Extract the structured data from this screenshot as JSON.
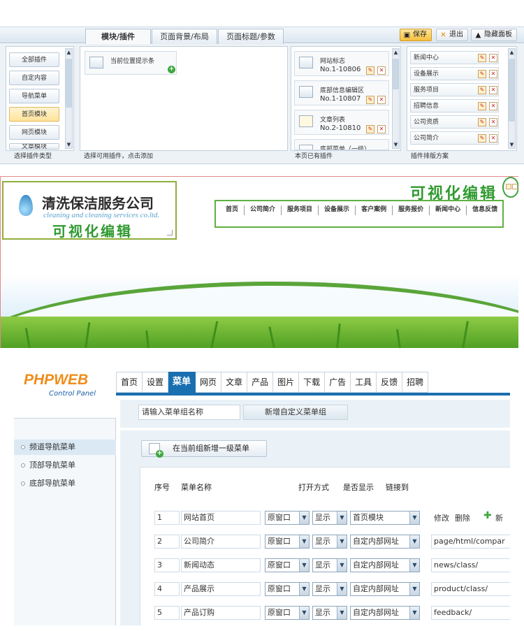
{
  "editor": {
    "tabs": [
      "模块/插件",
      "页面背景/布局",
      "页面标题/参数"
    ],
    "buttons": {
      "save": "保存",
      "exit": "退出",
      "hide": "隐藏面板"
    },
    "categories": [
      "全部插件",
      "自定内容",
      "导航菜单",
      "首页模块",
      "网页模块",
      "文章模块"
    ],
    "available_plugin": "当前位置提示条",
    "page_plugins": [
      {
        "name": "网站标志",
        "code": "No.1-10806"
      },
      {
        "name": "底部信息编辑区",
        "code": "No.1-10807"
      },
      {
        "name": "文章列表",
        "code": "No.2-10810"
      },
      {
        "name": "底部菜单（一级）",
        "code": ""
      }
    ],
    "layout_items": [
      "新闻中心",
      "设备展示",
      "服务项目",
      "招聘信息",
      "公司资质",
      "公司简介"
    ],
    "footers": [
      "选择插件类型",
      "选择可用插件，点击添加",
      "本页已有插件",
      "插件排版方案"
    ]
  },
  "preview": {
    "company_cn": "清洗保洁服务公司",
    "company_en": "cleaning and cleaning services co.ltd.",
    "visual_edit": "可视化编辑",
    "nav": [
      "首页",
      "公司简介",
      "服务项目",
      "设备展示",
      "客户案例",
      "服务报价",
      "新闻中心",
      "信息反馈"
    ]
  },
  "cp": {
    "logo_big": "PHPWEB",
    "logo_small": "Control Panel",
    "tabs": [
      "首页",
      "设置",
      "菜单",
      "网页",
      "文章",
      "产品",
      "图片",
      "下载",
      "广告",
      "工具",
      "反馈",
      "招聘"
    ],
    "group_placeholder": "请输入菜单组名称",
    "group_add": "新增自定义菜单组",
    "side": [
      "频道导航菜单",
      "顶部导航菜单",
      "底部导航菜单"
    ],
    "add_first": "在当前组新增一级菜单",
    "headers": {
      "seq": "序号",
      "name": "菜单名称",
      "open": "打开方式",
      "show": "是否显示",
      "link": "链接到"
    },
    "actions": {
      "edit": "修改",
      "delete": "删除",
      "new": "新"
    },
    "rows": [
      {
        "seq": "1",
        "name": "网站首页",
        "open": "原窗口",
        "show": "显示",
        "target": "首页模块",
        "url": ""
      },
      {
        "seq": "2",
        "name": "公司简介",
        "open": "原窗口",
        "show": "显示",
        "target": "自定内部网址",
        "url": "page/html/compar"
      },
      {
        "seq": "3",
        "name": "新闻动态",
        "open": "原窗口",
        "show": "显示",
        "target": "自定内部网址",
        "url": "news/class/"
      },
      {
        "seq": "4",
        "name": "产品展示",
        "open": "原窗口",
        "show": "显示",
        "target": "自定内部网址",
        "url": "product/class/"
      },
      {
        "seq": "5",
        "name": "产品订购",
        "open": "原窗口",
        "show": "显示",
        "target": "自定内部网址",
        "url": "feedback/"
      }
    ]
  }
}
